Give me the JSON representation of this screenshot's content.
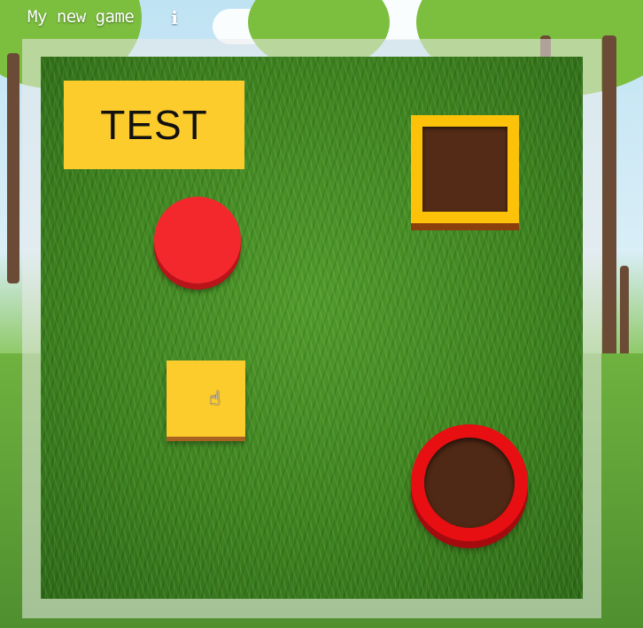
{
  "header": {
    "title": "My new game",
    "info_icon": "info-icon"
  },
  "game": {
    "label_text": "TEST",
    "pieces": [
      {
        "name": "red-circle-piece",
        "shape": "circle",
        "color": "#f2282d"
      },
      {
        "name": "yellow-square-piece",
        "shape": "square",
        "color": "#fccb2c"
      }
    ],
    "targets": [
      {
        "name": "square-hole",
        "shape": "square",
        "rim_color": "#fcc20a"
      },
      {
        "name": "circle-hole",
        "shape": "circle",
        "rim_color": "#e70f12"
      }
    ],
    "cursor_icon": "hand-pointer-icon"
  },
  "colors": {
    "label_bg": "#fccb2c",
    "grass": "#3e8a20",
    "hole_interior": "#532b16"
  }
}
